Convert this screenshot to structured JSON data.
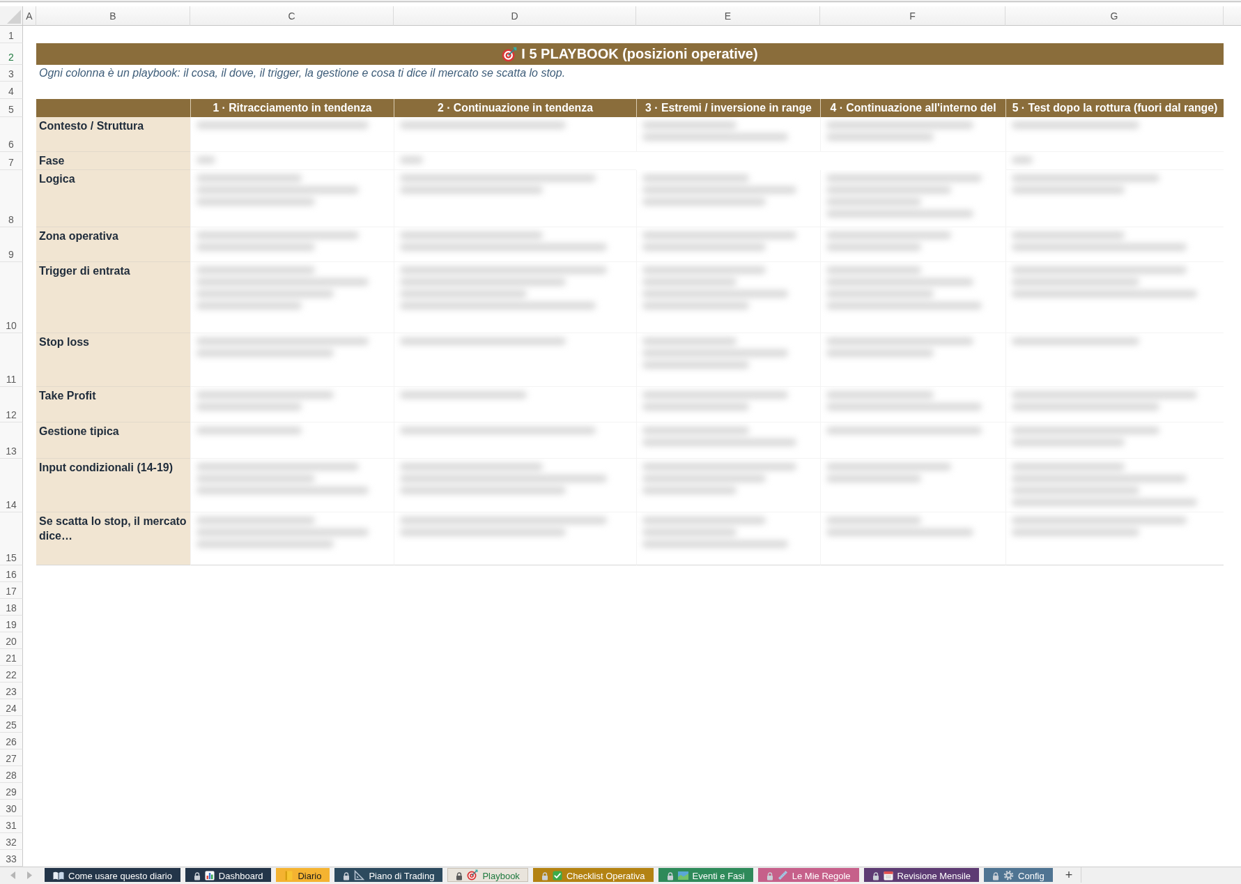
{
  "column_headers": [
    "A",
    "B",
    "C",
    "D",
    "E",
    "F",
    "G"
  ],
  "row_headers": [
    {
      "label": "1",
      "selected": false
    },
    {
      "label": "2",
      "selected": true
    },
    {
      "label": "3",
      "selected": false
    },
    {
      "label": "4",
      "selected": false
    },
    {
      "label": "5",
      "selected": false
    },
    {
      "label": "6",
      "selected": false
    },
    {
      "label": "7",
      "selected": false
    },
    {
      "label": "8",
      "selected": false
    },
    {
      "label": "9",
      "selected": false
    },
    {
      "label": "10",
      "selected": false
    },
    {
      "label": "11",
      "selected": false
    },
    {
      "label": "12",
      "selected": false
    },
    {
      "label": "13",
      "selected": false
    },
    {
      "label": "14",
      "selected": false
    },
    {
      "label": "15",
      "selected": false
    },
    {
      "label": "16",
      "selected": false
    },
    {
      "label": "17",
      "selected": false
    },
    {
      "label": "18",
      "selected": false
    },
    {
      "label": "19",
      "selected": false
    },
    {
      "label": "20",
      "selected": false
    },
    {
      "label": "21",
      "selected": false
    },
    {
      "label": "22",
      "selected": false
    },
    {
      "label": "23",
      "selected": false
    },
    {
      "label": "24",
      "selected": false
    },
    {
      "label": "25",
      "selected": false
    },
    {
      "label": "26",
      "selected": false
    },
    {
      "label": "27",
      "selected": false
    },
    {
      "label": "28",
      "selected": false
    },
    {
      "label": "29",
      "selected": false
    },
    {
      "label": "30",
      "selected": false
    },
    {
      "label": "31",
      "selected": false
    },
    {
      "label": "32",
      "selected": false
    },
    {
      "label": "33",
      "selected": false
    }
  ],
  "banner": {
    "title": "I 5 PLAYBOOK (posizioni operative)"
  },
  "subtitle": "Ogni colonna è un playbook: il cosa, il dove, il trigger, la gestione e cosa ti dice il mercato se scatta lo stop.",
  "table": {
    "columns": [
      "1 · Ritracciamento in tendenza",
      "2 · Continuazione in tendenza",
      "3 · Estremi / inversione in range",
      "4 · Continuazione all'interno del",
      "5 · Test dopo la rottura (fuori dal range)"
    ],
    "rows": [
      "Contesto / Struttura",
      "Fase",
      "Logica",
      "Zona operativa",
      "Trigger di entrata",
      "Stop loss",
      "Take Profit",
      "Gestione tipica",
      "Input condizionali (14-19)",
      "Se scatta lo stop, il mercato dice…"
    ]
  },
  "sheet_tabs": [
    {
      "label": "Come usare questo diario",
      "locked": false,
      "selected": false,
      "color": "#233549"
    },
    {
      "label": "Dashboard",
      "locked": true,
      "selected": false,
      "color": "#233549"
    },
    {
      "label": "Diario",
      "locked": false,
      "selected": false,
      "color": "#f4b331"
    },
    {
      "label": "Piano di Trading",
      "locked": true,
      "selected": false,
      "color": "#2c4a5e"
    },
    {
      "label": "Playbook",
      "locked": true,
      "selected": true,
      "color": "#e9e4dc"
    },
    {
      "label": "Checklist Operativa",
      "locked": true,
      "selected": false,
      "color": "#b38212"
    },
    {
      "label": "Eventi e Fasi",
      "locked": true,
      "selected": false,
      "color": "#2e8a5a"
    },
    {
      "label": "Le Mie Regole",
      "locked": true,
      "selected": false,
      "color": "#c6608a"
    },
    {
      "label": "Revisione Mensile",
      "locked": true,
      "selected": false,
      "color": "#5d3b73"
    },
    {
      "label": "Config",
      "locked": true,
      "selected": false,
      "color": "#4f7492"
    }
  ],
  "add_sheet": "+"
}
